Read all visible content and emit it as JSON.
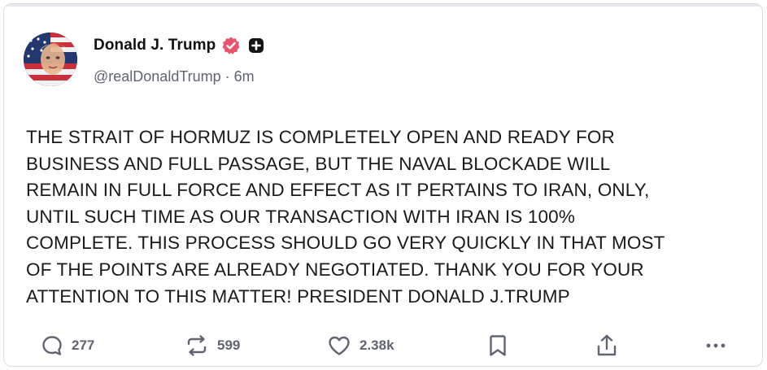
{
  "post": {
    "author": {
      "display_name": "Donald J. Trump",
      "handle": "@realDonaldTrump",
      "separator": "·",
      "time_ago": "6m",
      "verified": true
    },
    "text": "THE STRAIT OF HORMUZ IS COMPLETELY OPEN AND READY FOR\nBUSINESS AND FULL PASSAGE, BUT THE NAVAL BLOCKADE WILL\nREMAIN IN FULL FORCE AND EFFECT AS IT PERTAINS TO IRAN, ONLY,\nUNTIL SUCH TIME AS OUR TRANSACTION WITH IRAN IS 100%\nCOMPLETE. THIS PROCESS SHOULD GO VERY QUICKLY IN THAT MOST\nOF THE POINTS ARE ALREADY NEGOTIATED. THANK YOU FOR YOUR\nATTENTION TO THIS MATTER! PRESIDENT DONALD J.TRUMP",
    "actions": {
      "replies": "277",
      "reposts": "599",
      "likes": "2.38k"
    }
  },
  "icons": {
    "verified": "verified-badge-icon",
    "plus": "plus-square-icon",
    "reply": "reply-bubble-icon",
    "repost": "repost-arrows-icon",
    "like": "heart-icon",
    "bookmark": "bookmark-icon",
    "share": "share-upload-icon",
    "more": "more-dots-icon"
  },
  "colors": {
    "verified_badge": "#e8546f",
    "muted_text": "#5f6470",
    "body_text": "#1a1a1a"
  }
}
